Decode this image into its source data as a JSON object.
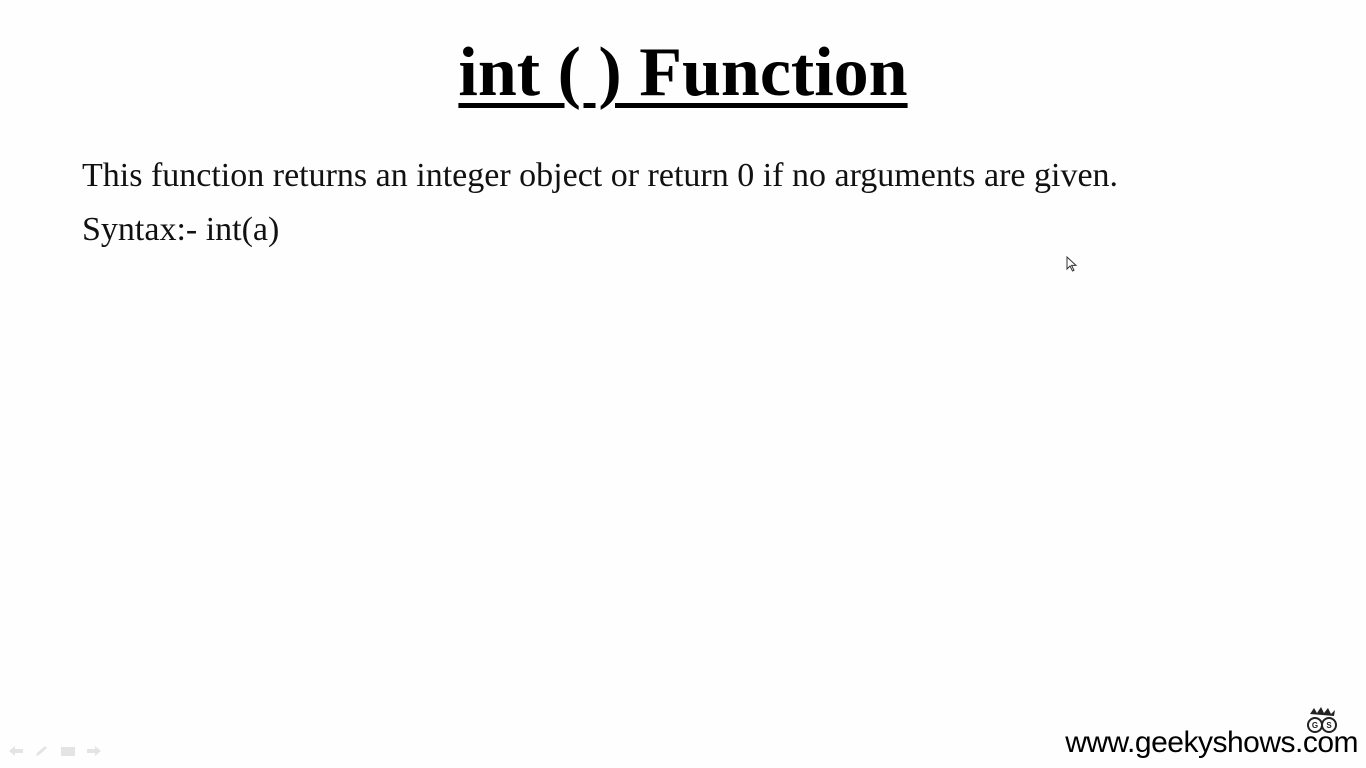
{
  "slide": {
    "title": "int ( ) Function",
    "lines": [
      "This function returns an integer object or return 0 if no arguments are given.",
      "Syntax:- int(a)"
    ]
  },
  "watermark": {
    "text": "www.geekyshows.com",
    "logo_text": "GS"
  },
  "icons": {
    "cursor": "mouse-pointer-icon",
    "controls": [
      "previous-slide-icon",
      "pen-icon",
      "slide-menu-icon",
      "next-slide-icon"
    ],
    "logo": "geekyshows-logo-icon"
  }
}
